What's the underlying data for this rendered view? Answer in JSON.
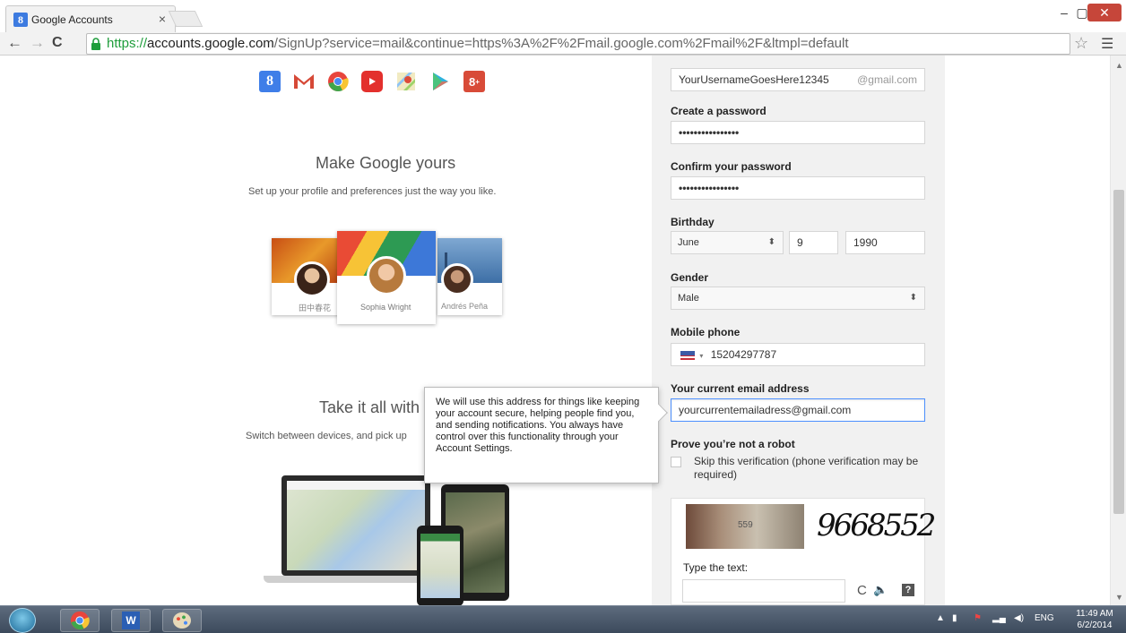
{
  "browser": {
    "tab_title": "Google Accounts",
    "tab_close": "×",
    "favicon_letter": "8",
    "url_scheme": "https://",
    "url_host": "accounts.google.com",
    "url_path": "/SignUp?service=mail&continue=https%3A%2F%2Fmail.google.com%2Fmail%2F&ltmpl=default",
    "window_controls": {
      "minimize": "–",
      "maximize": "▢",
      "close": "✕"
    }
  },
  "left": {
    "product_icons": [
      "google-search-icon",
      "gmail-icon",
      "chrome-icon",
      "youtube-icon",
      "maps-icon",
      "play-icon",
      "google-plus-icon"
    ],
    "section1": {
      "title": "Make Google yours",
      "subtitle": "Set up your profile and preferences just the way you like."
    },
    "profile_names": [
      "田中春花",
      "Sophia Wright",
      "Andrés Peña"
    ],
    "section2": {
      "title": "Take it all with",
      "subtitle": "Switch between devices, and pick up"
    }
  },
  "tooltip": {
    "text": "We will use this address for things like keeping your account secure, helping people find you, and sending notifications. You always have control over this functionality through your Account Settings."
  },
  "form": {
    "username_value": "YourUsernameGoesHere12345",
    "username_suffix": "@gmail.com",
    "password_label": "Create a password",
    "password_value": "••••••••••••••••",
    "confirm_label": "Confirm your password",
    "confirm_value": "••••••••••••••••",
    "birthday_label": "Birthday",
    "birth_month": "June",
    "birth_day": "9",
    "birth_year": "1990",
    "gender_label": "Gender",
    "gender_value": "Male",
    "phone_label": "Mobile phone",
    "phone_value": "15204297787",
    "email_label": "Your current email address",
    "email_value": "yourcurrentemailadress@gmail.com",
    "robot_label": "Prove you’re not a robot",
    "skip_text": "Skip this verification (phone verification may be required)",
    "captcha_number_a": "559",
    "captcha_number_b": "9668552",
    "type_text_label": "Type the text:"
  },
  "taskbar": {
    "lang": "ENG",
    "time": "11:49 AM",
    "date": "6/2/2014"
  }
}
